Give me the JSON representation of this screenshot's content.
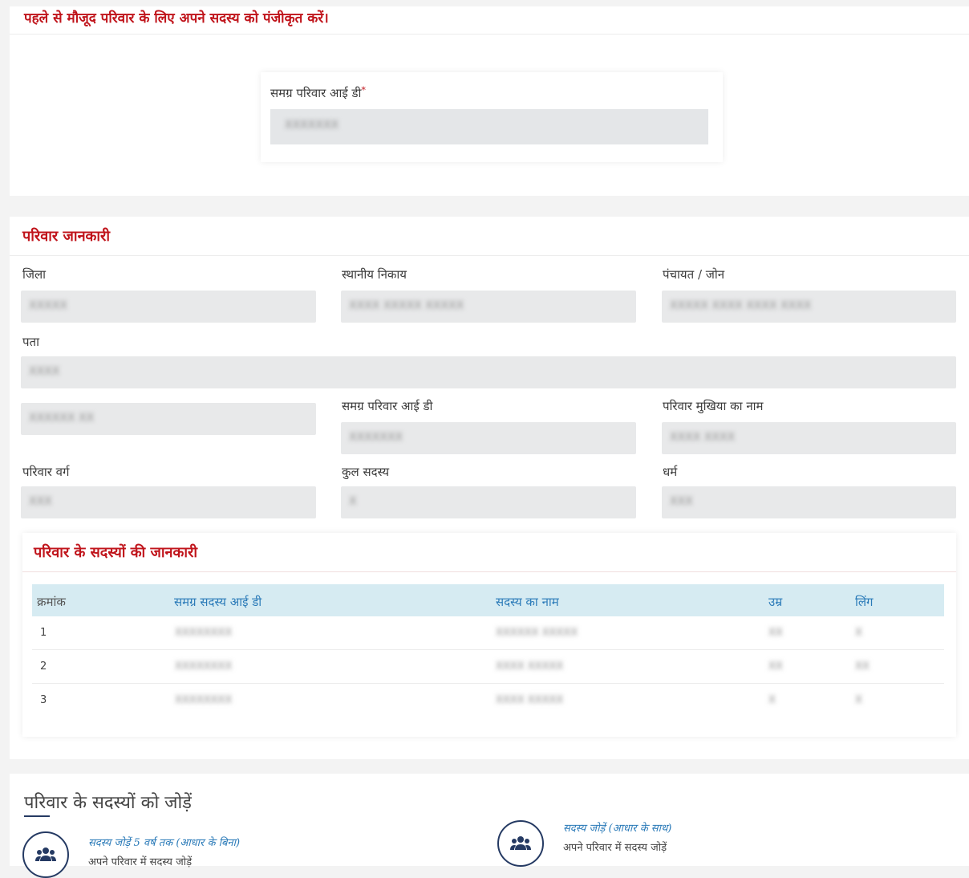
{
  "register_section": {
    "title": "पहले से मौजूद परिवार के लिए अपने सदस्य को पंजीकृत करें।",
    "id_label": "समग्र परिवार आई डी",
    "required_mark": "*",
    "id_value": "XXXXXXX"
  },
  "family_info": {
    "title": "परिवार जानकारी",
    "district_label": "जिला",
    "district_value": "XXXXX",
    "local_body_label": "स्थानीय निकाय",
    "local_body_value": "XXXX XXXXX XXXXX",
    "panchayat_label": "पंचायत / जोन",
    "panchayat_value": "XXXXX XXXX XXXX XXXX",
    "address_label": "पता",
    "address_value": "XXXX",
    "extra_value": "XXXXXX XX",
    "family_id_label": "समग्र परिवार आई डी",
    "family_id_value": "XXXXXXX",
    "head_label": "परिवार मुखिया का नाम",
    "head_value": "XXXX XXXX",
    "category_label": "परिवार वर्ग",
    "category_value": "XXX",
    "total_label": "कुल सदस्य",
    "total_value": "X",
    "religion_label": "धर्म",
    "religion_value": "XXX"
  },
  "members": {
    "title": "परिवार के सदस्यों की जानकारी",
    "headers": [
      "क्रमांक",
      "समग्र सदस्य आई डी",
      "सदस्य का नाम",
      "उम्र",
      "लिंग"
    ],
    "rows": [
      [
        "1",
        "XXXXXXXX",
        "XXXXXX XXXXX",
        "XX",
        "X"
      ],
      [
        "2",
        "XXXXXXXX",
        "XXXX XXXXX",
        "XX",
        "XX"
      ],
      [
        "3",
        "XXXXXXXX",
        "XXXX XXXXX",
        "X",
        "X"
      ]
    ]
  },
  "add_members": {
    "title": "परिवार के सदस्यों को जोड़ें",
    "option1_title": "सदस्य जोड़ें 5 वर्ष तक (आधार के बिना)",
    "option1_sub": "अपने परिवार में सदस्य जोड़ें",
    "option2_title": "सदस्य जोड़ें (आधार के साथ)",
    "option2_sub": "अपने परिवार में सदस्य जोड़ें",
    "icon": "users-icon",
    "icon_color": "#253a63"
  },
  "colors": {
    "accent_red": "#c0141b",
    "link_blue": "#2a7ab8",
    "table_header_bg": "#d6ebf2"
  }
}
